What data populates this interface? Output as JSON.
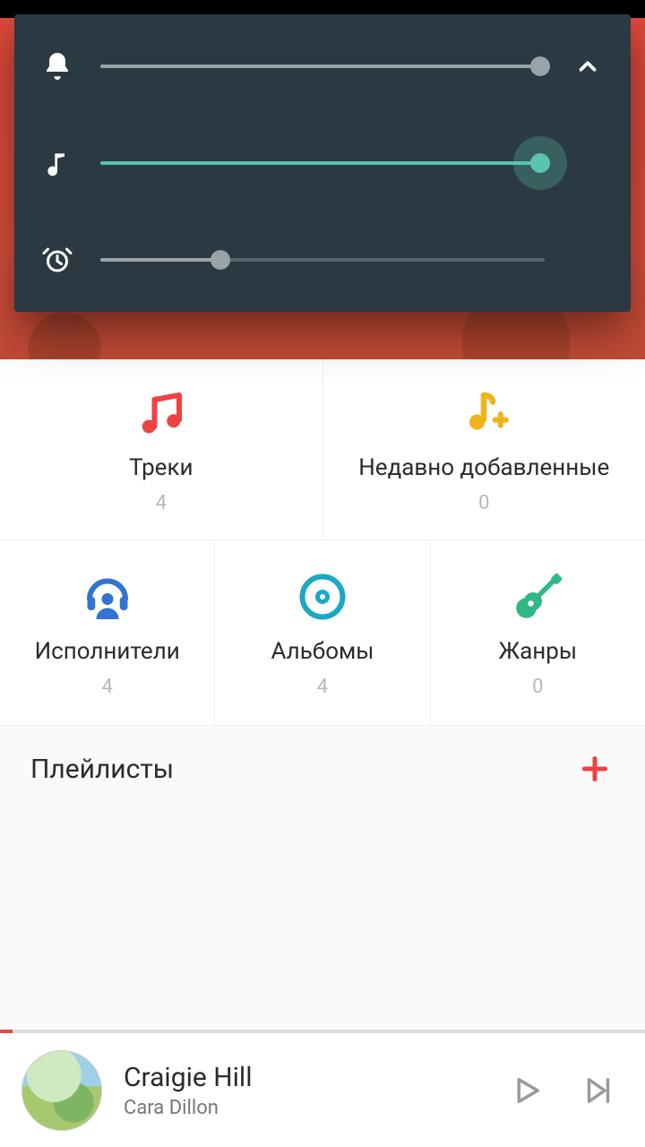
{
  "colors": {
    "accent_red": "#ef4244",
    "accent_yellow": "#f0b31a",
    "accent_blue": "#3373d1",
    "accent_teal": "#1aa8c4",
    "accent_green": "#2fb885",
    "slider_teal": "#5bc4ae",
    "slider_gray": "#9aa3a8",
    "panel_bg": "#2b3942"
  },
  "volume_panel": {
    "sliders": {
      "ringer": {
        "value_pct": 99,
        "fill_color": "#9aa3a8",
        "thumb_color": "#9aa3a8"
      },
      "media": {
        "value_pct": 99,
        "fill_color": "#5bc4ae",
        "thumb_color": "#5bc4ae",
        "halo": true
      },
      "alarm": {
        "value_pct": 27,
        "fill_color": "#9aa3a8",
        "thumb_color": "#9aa3a8"
      }
    }
  },
  "categories": {
    "row1": [
      {
        "key": "tracks",
        "label": "Треки",
        "count": "4",
        "icon": "music-note-icon",
        "color": "#ef4244"
      },
      {
        "key": "recent",
        "label": "Недавно добавленные",
        "count": "0",
        "icon": "note-plus-icon",
        "color": "#f0b31a"
      }
    ],
    "row2": [
      {
        "key": "artists",
        "label": "Исполнители",
        "count": "4",
        "icon": "headphones-person-icon",
        "color": "#3373d1"
      },
      {
        "key": "albums",
        "label": "Альбомы",
        "count": "4",
        "icon": "disc-icon",
        "color": "#1aa8c4"
      },
      {
        "key": "genres",
        "label": "Жанры",
        "count": "0",
        "icon": "guitar-icon",
        "color": "#2fb885"
      }
    ]
  },
  "playlists": {
    "title": "Плейлисты"
  },
  "player": {
    "track_title": "Craigie Hill",
    "artist": "Cara Dillon",
    "progress_pct": 2
  }
}
